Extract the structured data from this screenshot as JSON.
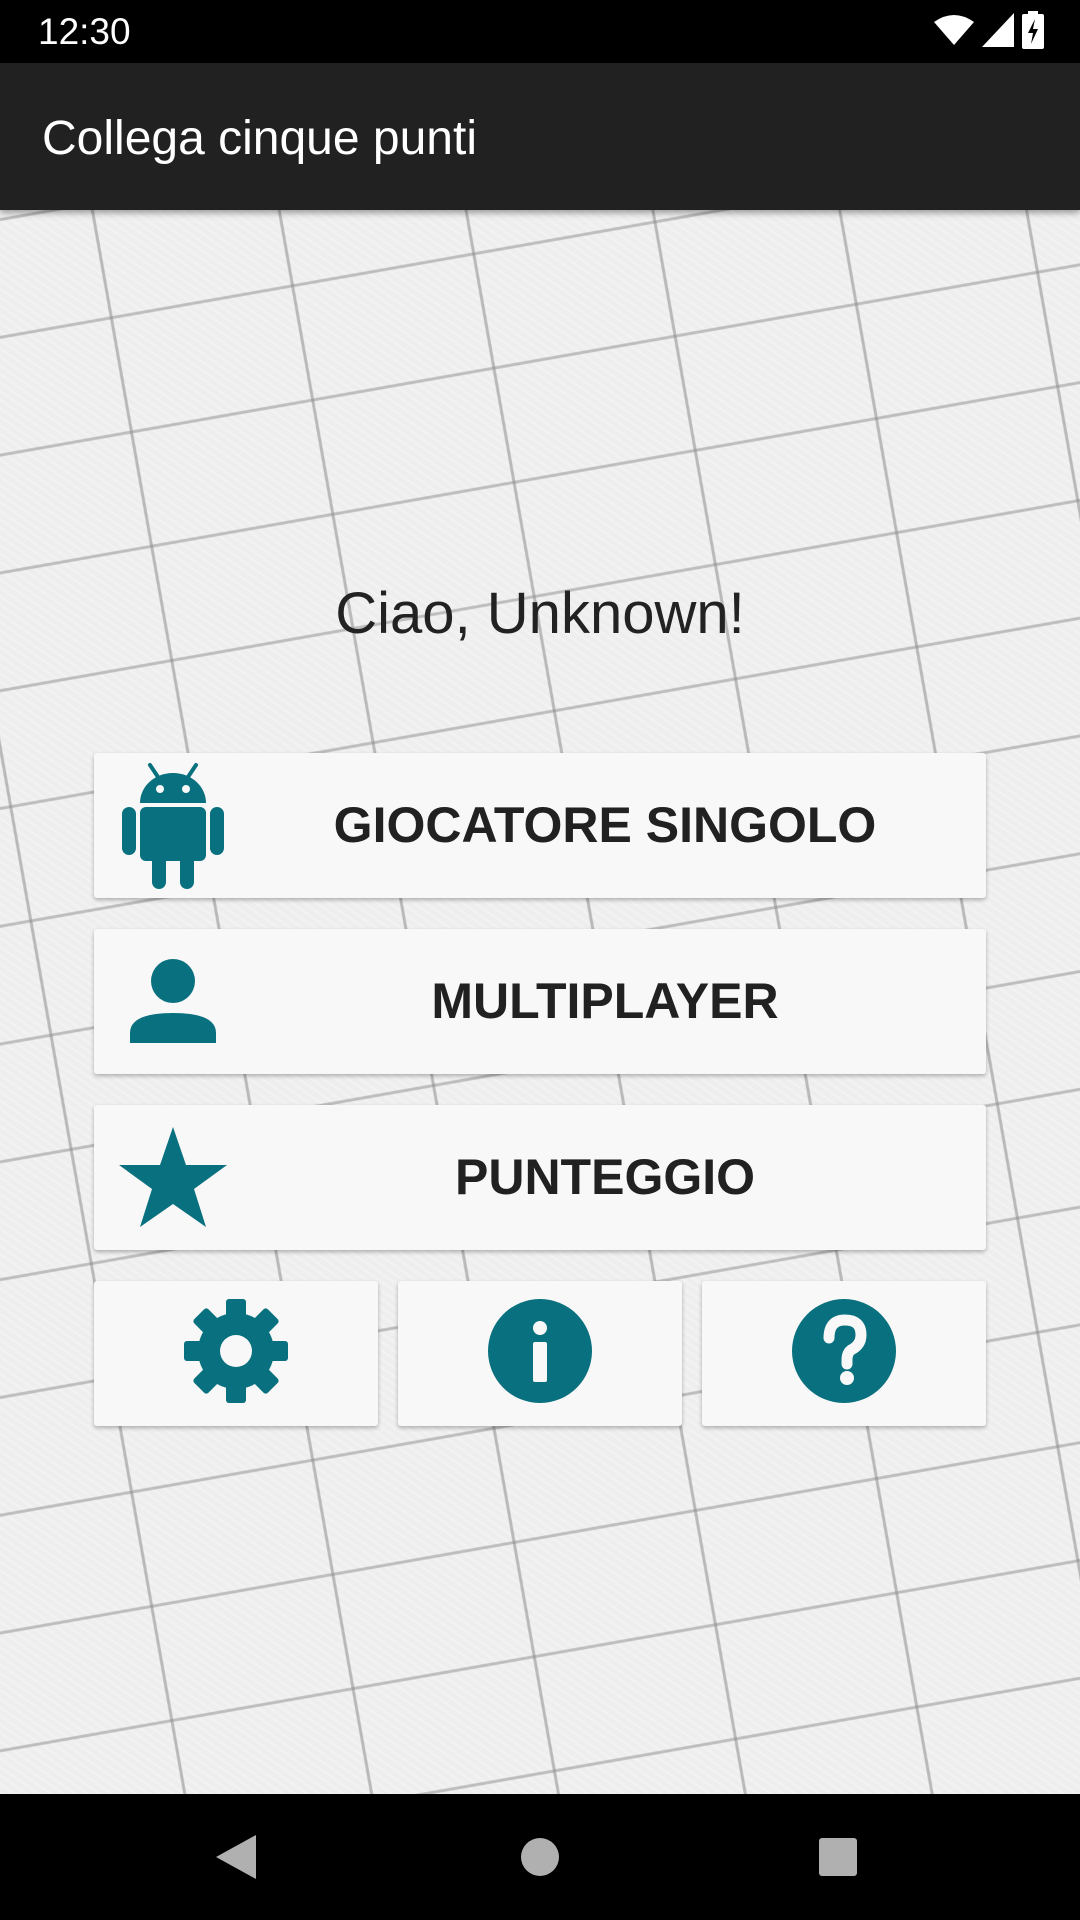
{
  "status_bar": {
    "time": "12:30",
    "icons": [
      "wifi-icon",
      "cell-signal-icon",
      "battery-charging-icon"
    ]
  },
  "app_bar": {
    "title": "Collega cinque punti"
  },
  "main": {
    "greeting": "Ciao, Unknown!",
    "menu_buttons": [
      {
        "label": "GIOCATORE SINGOLO",
        "icon": "android-icon"
      },
      {
        "label": "MULTIPLAYER",
        "icon": "person-icon"
      },
      {
        "label": "PUNTEGGIO",
        "icon": "star-icon"
      }
    ],
    "small_buttons": [
      {
        "icon": "gear-icon"
      },
      {
        "icon": "info-icon"
      },
      {
        "icon": "help-icon"
      }
    ]
  },
  "nav_bar": {
    "buttons": [
      "back-icon",
      "home-icon",
      "recents-icon"
    ]
  },
  "colors": {
    "accent": "#08707e",
    "app_bar": "#212121",
    "button_bg": "#f8f8f8"
  }
}
